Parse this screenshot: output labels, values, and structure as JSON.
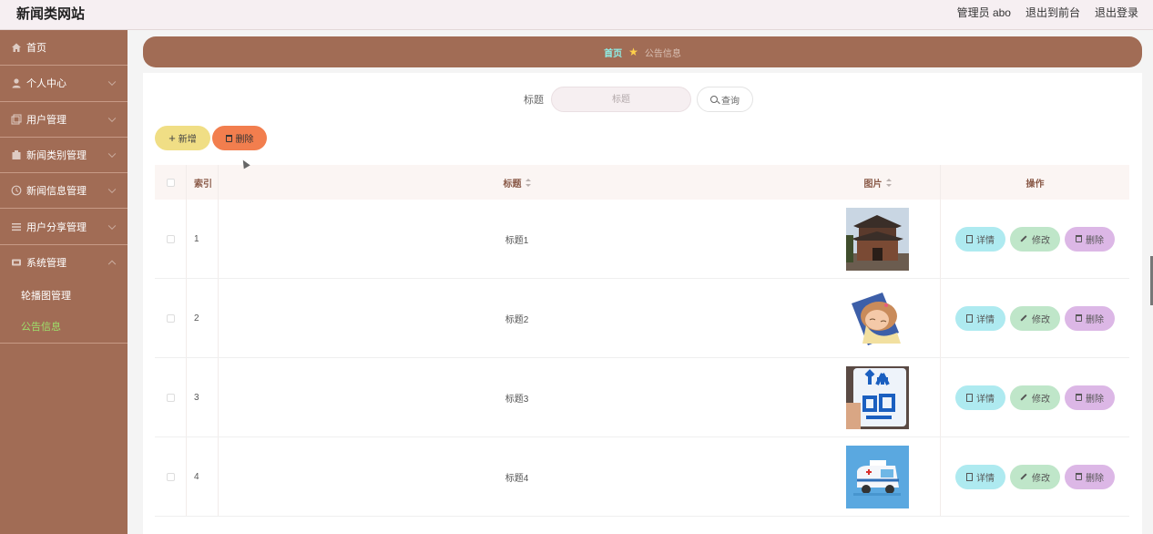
{
  "header": {
    "site_title": "新闻类网站",
    "user": "管理员 abo",
    "to_frontend": "退出到前台",
    "logout": "退出登录"
  },
  "sidebar": {
    "items": [
      {
        "label": "首页",
        "icon": "home-icon"
      },
      {
        "label": "个人中心",
        "icon": "user-icon"
      },
      {
        "label": "用户管理",
        "icon": "users-icon"
      },
      {
        "label": "新闻类别管理",
        "icon": "category-icon"
      },
      {
        "label": "新闻信息管理",
        "icon": "news-icon"
      },
      {
        "label": "用户分享管理",
        "icon": "list-icon"
      },
      {
        "label": "系统管理",
        "icon": "system-icon"
      }
    ],
    "sub_items": [
      {
        "label": "轮播图管理",
        "active": false
      },
      {
        "label": "公告信息",
        "active": true
      }
    ],
    "active_color": "#9ee06b",
    "background": "#a16c55"
  },
  "breadcrumb": {
    "home": "首页",
    "current": "公告信息"
  },
  "search": {
    "label": "标题",
    "placeholder": "标题",
    "button": "查询"
  },
  "actions": {
    "add": "新增",
    "delete": "删除"
  },
  "table": {
    "headers": {
      "index": "索引",
      "title": "标题",
      "image": "图片",
      "ops": "操作"
    },
    "op_labels": {
      "detail": "详情",
      "edit": "修改",
      "delete": "删除"
    },
    "rows": [
      {
        "index": "1",
        "title": "标题1",
        "image": "temple-photo"
      },
      {
        "index": "2",
        "title": "标题2",
        "image": "sleeping-girl-illustration"
      },
      {
        "index": "3",
        "title": "标题3",
        "image": "personal-info-phone-photo"
      },
      {
        "index": "4",
        "title": "标题4",
        "image": "ambulance-illustration"
      }
    ]
  }
}
